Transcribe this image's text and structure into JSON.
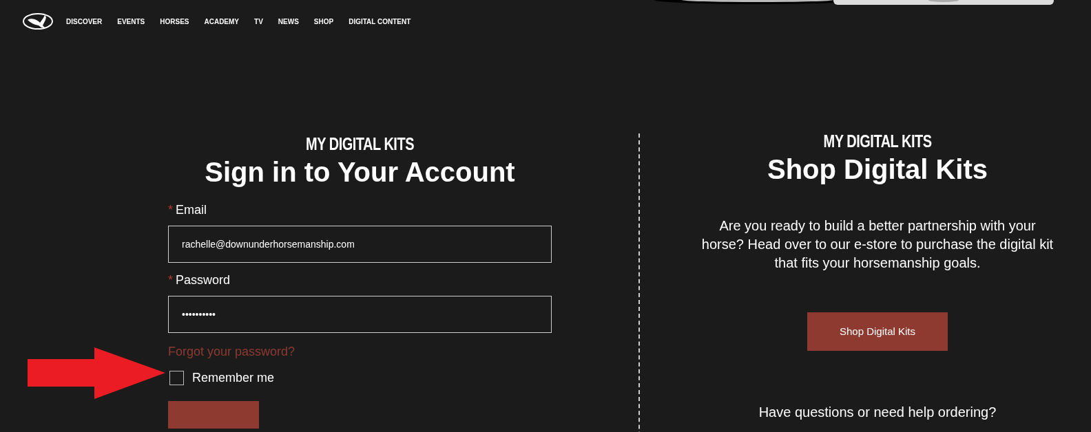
{
  "nav": {
    "items": [
      "DISCOVER",
      "EVENTS",
      "HORSES",
      "ACADEMY",
      "TV",
      "NEWS",
      "SHOP",
      "DIGITAL CONTENT"
    ]
  },
  "sign_in": {
    "kicker": "MY DIGITAL KITS",
    "title": "Sign in to Your Account",
    "fields": [
      {
        "label": "Email",
        "required_mark": "*",
        "value": "rachelle@downunderhorsemanship.com"
      },
      {
        "label": "Password",
        "required_mark": "*",
        "value": "••••••••••"
      }
    ],
    "forgot_link": "Forgot your password?",
    "remember": {
      "label": "Remember me",
      "checked": false
    }
  },
  "shop": {
    "kicker": "MY DIGITAL KITS",
    "title": "Shop Digital Kits",
    "text": "Are you ready to build a better partnership with your horse? Head over to our e-store to purchase the digital kit that fits your horsemanship goals.",
    "button": "Shop Digital Kits",
    "help": "Have questions or need help ordering?"
  }
}
